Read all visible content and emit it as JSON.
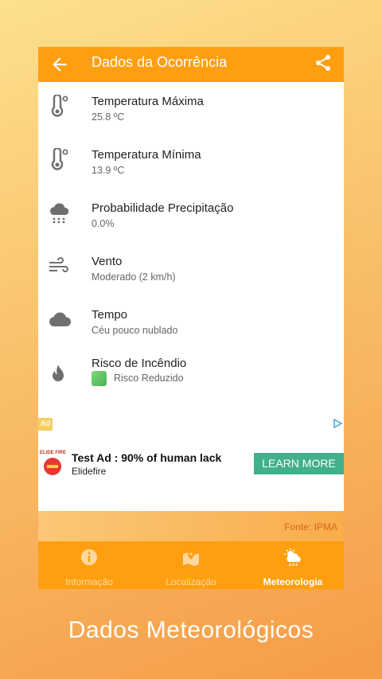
{
  "appbar": {
    "title": "Dados da Ocorrência"
  },
  "items": [
    {
      "label": "Temperatura Máxima",
      "value": "25.8 ºC",
      "icon": "thermometer-icon"
    },
    {
      "label": "Temperatura Mínima",
      "value": "13.9 ºC",
      "icon": "thermometer-icon"
    },
    {
      "label": "Probabilidade Precipitação",
      "value": "0.0%",
      "icon": "rain-cloud-icon"
    },
    {
      "label": "Vento",
      "value": "Moderado (2 km/h)",
      "icon": "wind-icon"
    },
    {
      "label": "Tempo",
      "value": "Céu pouco nublado",
      "icon": "cloud-icon"
    },
    {
      "label": "Risco de Incêndio",
      "value": "Risco Reduzido",
      "icon": "fire-icon",
      "level_color": "#5cbf60"
    }
  ],
  "ad": {
    "badge": "Ad",
    "logo_text": "ELIDE FIRE",
    "title": "Test Ad : 90% of human lack",
    "advertiser": "Elidefire",
    "cta": "LEARN MORE"
  },
  "source": "Fonte: IPMA",
  "tabs": [
    {
      "label": "Informação",
      "icon": "info-icon",
      "active": false
    },
    {
      "label": "Localização",
      "icon": "map-icon",
      "active": false
    },
    {
      "label": "Meteorologia",
      "icon": "weather-icon",
      "active": true
    }
  ],
  "caption": "Dados Meteorológicos",
  "colors": {
    "accent": "#ff9f10",
    "cta": "#41b08b",
    "icon_gray": "#6f6f6f"
  }
}
